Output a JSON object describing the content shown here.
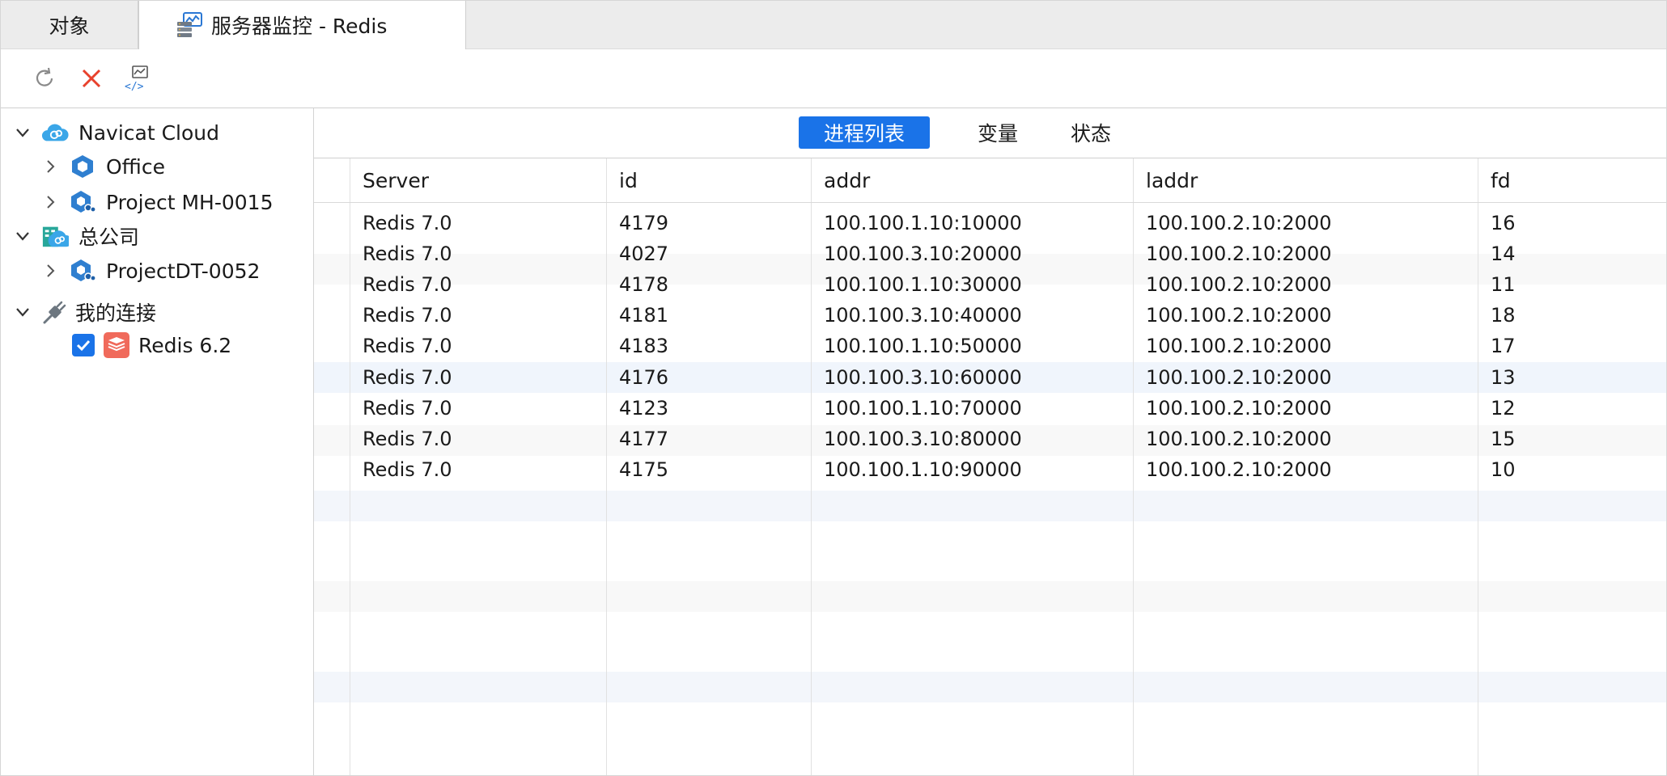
{
  "tabs": {
    "objects_label": "对象",
    "monitor_label": "服务器监控 - Redis"
  },
  "toolbar": {
    "icons": [
      "refresh-icon",
      "stop-icon",
      "script-icon"
    ]
  },
  "sidebar": {
    "nodes": [
      {
        "label": "Navicat Cloud",
        "icon": "cloud-icon",
        "expanded": true
      },
      {
        "label": "Office",
        "icon": "project-icon",
        "expanded": false
      },
      {
        "label": "Project MH-0015",
        "icon": "team-project-icon",
        "expanded": false
      },
      {
        "label": "总公司",
        "icon": "organization-icon",
        "expanded": true
      },
      {
        "label": "ProjectDT-0052",
        "icon": "team-project-icon",
        "expanded": false
      },
      {
        "label": "我的连接",
        "icon": "connection-plug-icon",
        "expanded": true
      },
      {
        "label": "Redis 6.2",
        "icon": "redis-icon",
        "checked": true
      }
    ]
  },
  "subtabs": {
    "process_list": "进程列表",
    "variables": "变量",
    "status": "状态",
    "active": "process_list"
  },
  "table": {
    "columns": [
      "Server",
      "id",
      "addr",
      "laddr",
      "fd"
    ],
    "rows": [
      [
        "Redis 7.0",
        "4179",
        "100.100.1.10:10000",
        "100.100.2.10:2000",
        "16"
      ],
      [
        "Redis 7.0",
        "4027",
        "100.100.3.10:20000",
        "100.100.2.10:2000",
        "14"
      ],
      [
        "Redis 7.0",
        "4178",
        "100.100.1.10:30000",
        "100.100.2.10:2000",
        "11"
      ],
      [
        "Redis 7.0",
        "4181",
        "100.100.3.10:40000",
        "100.100.2.10:2000",
        "18"
      ],
      [
        "Redis 7.0",
        "4183",
        "100.100.1.10:50000",
        "100.100.2.10:2000",
        "17"
      ],
      [
        "Redis 7.0",
        "4176",
        "100.100.3.10:60000",
        "100.100.2.10:2000",
        "13"
      ],
      [
        "Redis 7.0",
        "4123",
        "100.100.1.10:70000",
        "100.100.2.10:2000",
        "12"
      ],
      [
        "Redis 7.0",
        "4177",
        "100.100.3.10:80000",
        "100.100.2.10:2000",
        "15"
      ],
      [
        "Redis 7.0",
        "4175",
        "100.100.1.10:90000",
        "100.100.2.10:2000",
        "10"
      ]
    ]
  },
  "colors": {
    "accent": "#1a73e8",
    "stop": "#e8412c",
    "redis": "#f06a5b",
    "cloud": "#3aa6e8"
  }
}
